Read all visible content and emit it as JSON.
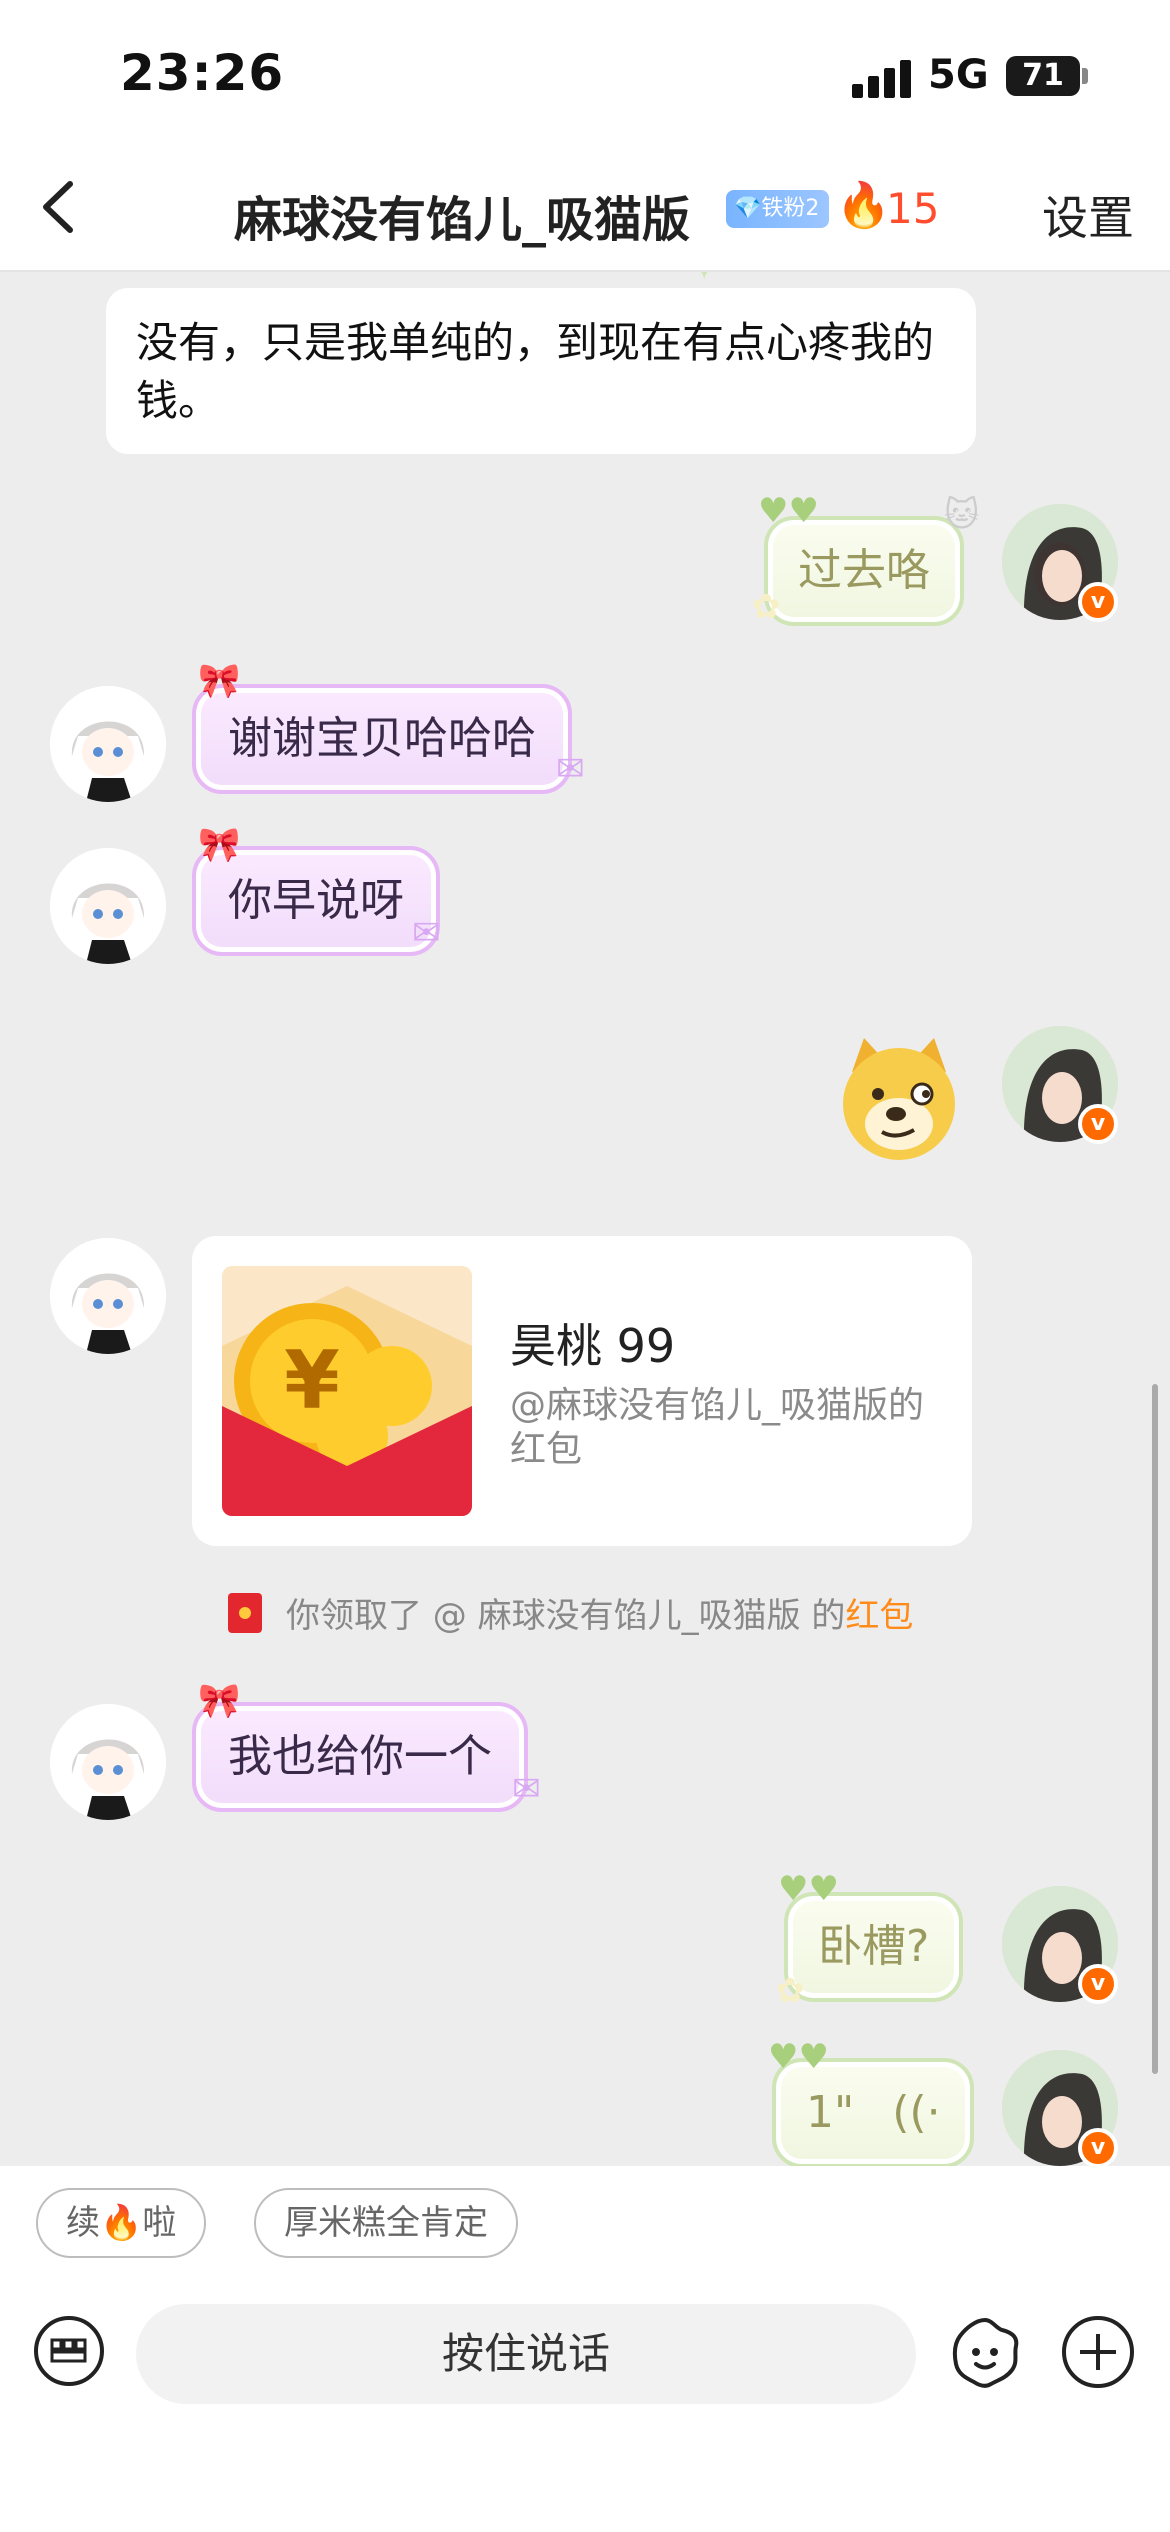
{
  "status_bar": {
    "time": "23:26",
    "network": "5G",
    "battery": "71"
  },
  "header": {
    "title": "麻球没有馅儿_吸猫版",
    "fan_badge": "铁粉2",
    "fire_count": "15",
    "settings": "设置"
  },
  "messages": {
    "m1": {
      "text": "没有，只是我单纯的，到现在有点心疼我的钱。"
    },
    "m2": {
      "text": "过去咯"
    },
    "m3": {
      "text": "谢谢宝贝哈哈哈"
    },
    "m4": {
      "text": "你早说呀"
    },
    "m5": {
      "sticker": "doge-sticker"
    },
    "m6": {
      "red_packet_title": "昊桃 99",
      "red_packet_sub": "@麻球没有馅儿_吸猫版的红包"
    },
    "system": {
      "prefix": "你领取了 @ 麻球没有馅儿_吸猫版 的",
      "link": "红包"
    },
    "m7": {
      "text": "我也给你一个"
    },
    "m8": {
      "text": "卧槽?"
    },
    "m9": {
      "voice_duration": "1\"",
      "voice_glyph": "((·"
    }
  },
  "quick_replies": [
    "续🔥啦",
    "厚米糕全肯定"
  ],
  "input": {
    "hold_to_talk": "按住说话"
  },
  "colors": {
    "accent_orange": "#ff8c1a",
    "fire_red": "#ff4d2e",
    "bubble_purple_border": "#e6b8f5",
    "bubble_green_border": "#cfe5b6"
  }
}
